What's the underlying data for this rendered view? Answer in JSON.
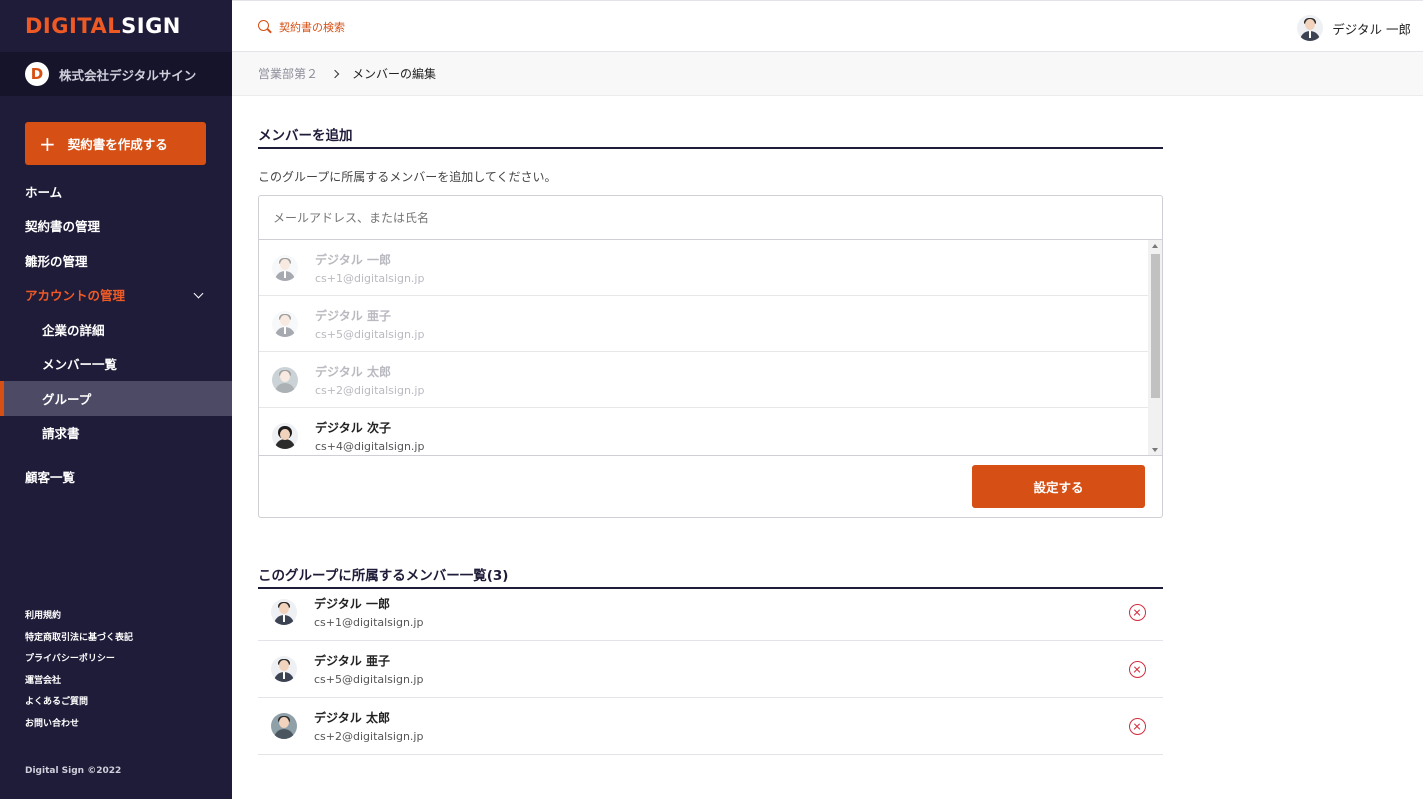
{
  "brand": {
    "logo_part1": "DIGITAL",
    "logo_part2": "SIGN",
    "accent_color": "#d64f14",
    "sidebar_color": "#1f1c39"
  },
  "company": {
    "badge": "D",
    "name": "株式会社デジタルサイン"
  },
  "sidebar": {
    "create_button": {
      "icon": "plus-icon",
      "label": "契約書を作成する"
    },
    "items": [
      {
        "label": "ホーム"
      },
      {
        "label": "契約書の管理"
      },
      {
        "label": "雛形の管理"
      },
      {
        "label": "アカウントの管理"
      },
      {
        "label": "企業の詳細"
      },
      {
        "label": "メンバー一覧"
      },
      {
        "label": "グループ"
      },
      {
        "label": "請求書"
      },
      {
        "label": "顧客一覧"
      }
    ],
    "footer_links": [
      "利用規約",
      "特定商取引法に基づく表記",
      "プライバシーポリシー",
      "運営会社",
      "よくあるご質問",
      "お問い合わせ"
    ],
    "copyright": "Digital Sign ©2022"
  },
  "header": {
    "search_label": "契約書の検索",
    "user_name": "デジタル 一郎"
  },
  "breadcrumb": {
    "parent": "営業部第２",
    "current": "メンバーの編集"
  },
  "add_section": {
    "title": "メンバーを追加",
    "description": "このグループに所属するメンバーを追加してください。",
    "input_placeholder": "メールアドレス、または氏名",
    "candidates": [
      {
        "name": "デジタル 一郎",
        "email": "cs+1@digitalsign.jp",
        "enabled": false
      },
      {
        "name": "デジタル 亜子",
        "email": "cs+5@digitalsign.jp",
        "enabled": false
      },
      {
        "name": "デジタル 太郎",
        "email": "cs+2@digitalsign.jp",
        "enabled": false
      },
      {
        "name": "デジタル 次子",
        "email": "cs+4@digitalsign.jp",
        "enabled": true
      }
    ],
    "submit_label": "設定する"
  },
  "members_section": {
    "title": "このグループに所属するメンバー一覧(3)",
    "members": [
      {
        "name": "デジタル 一郎",
        "email": "cs+1@digitalsign.jp"
      },
      {
        "name": "デジタル 亜子",
        "email": "cs+5@digitalsign.jp"
      },
      {
        "name": "デジタル 太郎",
        "email": "cs+2@digitalsign.jp"
      }
    ]
  }
}
